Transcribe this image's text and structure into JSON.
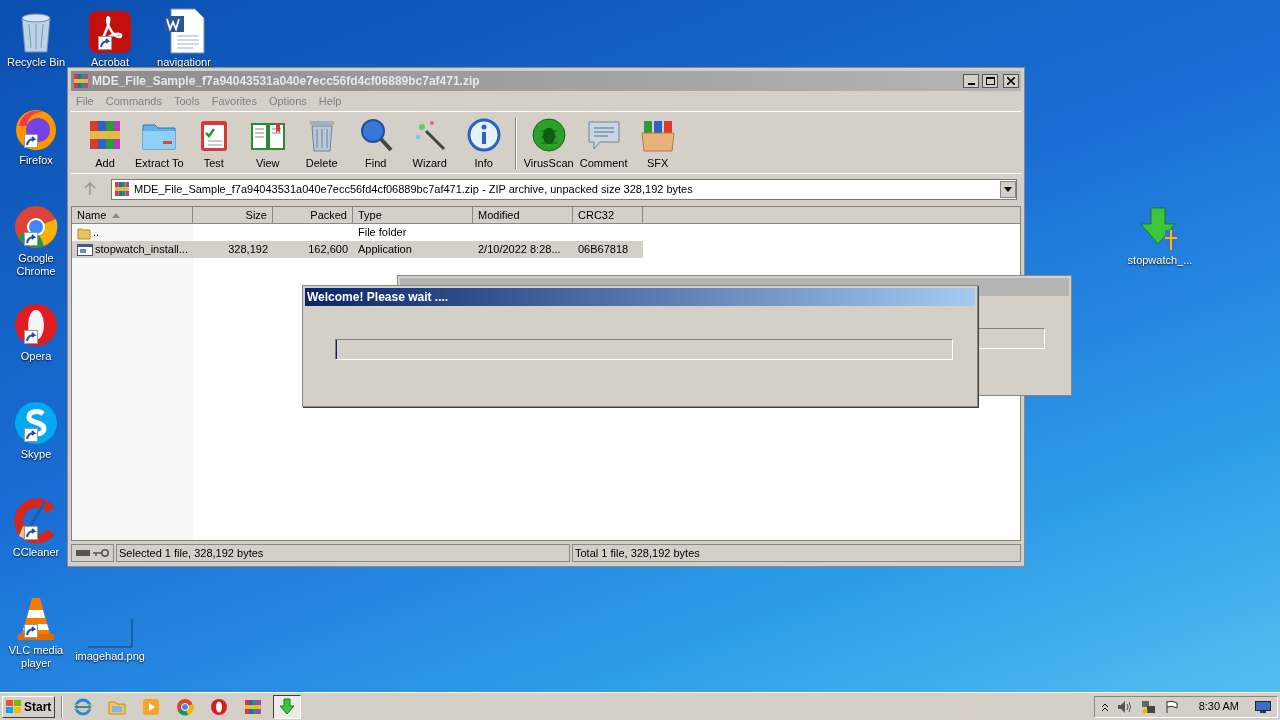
{
  "desktop_icons": [
    {
      "label": "Recycle Bin",
      "kind": "recycle",
      "shortcut": false
    },
    {
      "label": "Acrobat",
      "kind": "acrobat",
      "shortcut": true
    },
    {
      "label": "navigationr",
      "kind": "word",
      "shortcut": false
    },
    {
      "label": "Firefox",
      "kind": "firefox",
      "shortcut": true
    },
    {
      "label": "Google Chrome",
      "kind": "chrome",
      "shortcut": true
    },
    {
      "label": "Opera",
      "kind": "opera",
      "shortcut": true
    },
    {
      "label": "Skype",
      "kind": "skype",
      "shortcut": true
    },
    {
      "label": "CCleaner",
      "kind": "ccleaner",
      "shortcut": true
    },
    {
      "label": "VLC media player",
      "kind": "vlc",
      "shortcut": true
    },
    {
      "label": "imagehad.png",
      "kind": "image",
      "shortcut": false
    },
    {
      "label": "stopwatch_...",
      "kind": "installer",
      "shortcut": false
    }
  ],
  "window": {
    "title": "MDE_File_Sample_f7a94043531a040e7ecc56fd4cf06889bc7af471.zip",
    "menu": [
      "File",
      "Commands",
      "Tools",
      "Favorites",
      "Options",
      "Help"
    ],
    "toolbar": [
      {
        "label": "Add",
        "kind": "add"
      },
      {
        "label": "Extract To",
        "kind": "extract"
      },
      {
        "label": "Test",
        "kind": "test"
      },
      {
        "label": "View",
        "kind": "view"
      },
      {
        "label": "Delete",
        "kind": "delete"
      },
      {
        "label": "Find",
        "kind": "find"
      },
      {
        "label": "Wizard",
        "kind": "wizard"
      },
      {
        "label": "Info",
        "kind": "info"
      },
      {
        "label": "VirusScan",
        "kind": "virus"
      },
      {
        "label": "Comment",
        "kind": "comment"
      },
      {
        "label": "SFX",
        "kind": "sfx"
      }
    ],
    "path": "MDE_File_Sample_f7a94043531a040e7ecc56fd4cf06889bc7af471.zip - ZIP archive, unpacked size 328,192 bytes",
    "columns": [
      {
        "label": "Name",
        "sorted": true
      },
      {
        "label": "Size",
        "sorted": false
      },
      {
        "label": "Packed",
        "sorted": false
      },
      {
        "label": "Type",
        "sorted": false
      },
      {
        "label": "Modified",
        "sorted": false
      },
      {
        "label": "CRC32",
        "sorted": false
      }
    ],
    "rows": [
      {
        "kind": "folder",
        "name": "..",
        "size": "",
        "packed": "",
        "type": "File folder",
        "modified": "",
        "crc32": "",
        "selected": false
      },
      {
        "kind": "application",
        "name": "stopwatch_install...",
        "size": "328,192",
        "packed": "162,600",
        "type": "Application",
        "modified": "2/10/2022 8:28...",
        "crc32": "06B67818",
        "selected": true
      }
    ],
    "status_left": "Selected 1 file, 328,192 bytes",
    "status_right": "Total 1 file, 328,192 bytes"
  },
  "dialog": {
    "title": "Welcome! Please wait ....",
    "level": 0
  },
  "taskbar": {
    "start": "Start",
    "clock": "8:30 AM",
    "apps": [
      {
        "kind": "ie",
        "selected": false
      },
      {
        "kind": "explorer",
        "selected": false
      },
      {
        "kind": "media",
        "selected": false
      },
      {
        "kind": "chrome",
        "selected": false
      },
      {
        "kind": "opera",
        "selected": false
      },
      {
        "kind": "winrar",
        "selected": false
      },
      {
        "kind": "installer",
        "selected": true
      }
    ]
  }
}
